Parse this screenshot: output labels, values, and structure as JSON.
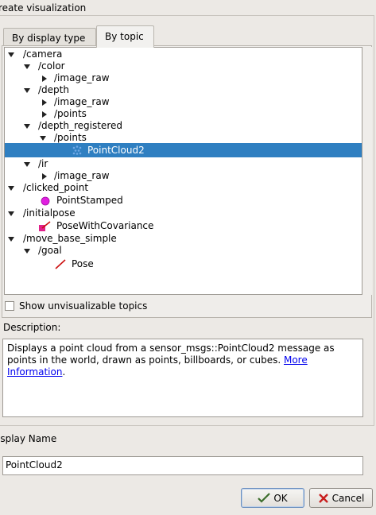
{
  "dialog": {
    "group_title": "reate visualization",
    "tabs": [
      {
        "label": "By display type",
        "active": false
      },
      {
        "label": "By topic",
        "active": true
      }
    ],
    "tree": [
      {
        "label": "/camera",
        "expanded": true
      },
      {
        "label": "/color",
        "expanded": true
      },
      {
        "label": "/image_raw",
        "expanded": false
      },
      {
        "label": "/depth",
        "expanded": true
      },
      {
        "label": "/image_raw",
        "expanded": false
      },
      {
        "label": "/points",
        "expanded": false
      },
      {
        "label": "/depth_registered",
        "expanded": true
      },
      {
        "label": "/points",
        "expanded": true
      },
      {
        "label": "PointCloud2",
        "selected": true,
        "icon": "point-cloud-icon"
      },
      {
        "label": "/ir",
        "expanded": true
      },
      {
        "label": "/image_raw",
        "expanded": false
      },
      {
        "label": "/clicked_point",
        "expanded": true
      },
      {
        "label": "PointStamped",
        "icon": "magenta-dot-icon"
      },
      {
        "label": "/initialpose",
        "expanded": true
      },
      {
        "label": "PoseWithCovariance",
        "icon": "pose-covariance-icon"
      },
      {
        "label": "/move_base_simple",
        "expanded": true
      },
      {
        "label": "/goal",
        "expanded": true
      },
      {
        "label": "Pose",
        "icon": "red-arrow-icon"
      }
    ],
    "show_unvisualizable_label": "Show unvisualizable topics",
    "show_unvisualizable_checked": false,
    "description_title": "Description:",
    "description": {
      "text": "Displays a point cloud from a sensor_msgs::PointCloud2 message as points in the world, drawn as points, billboards, or cubes. ",
      "link": "More Information",
      "tail": "."
    },
    "display_name_title": "isplay Name",
    "display_name_value": "PointCloud2",
    "ok_label": "OK",
    "cancel_label": "Cancel",
    "colors": {
      "selection": "#2f7fc1",
      "link": "#0000ee"
    }
  }
}
